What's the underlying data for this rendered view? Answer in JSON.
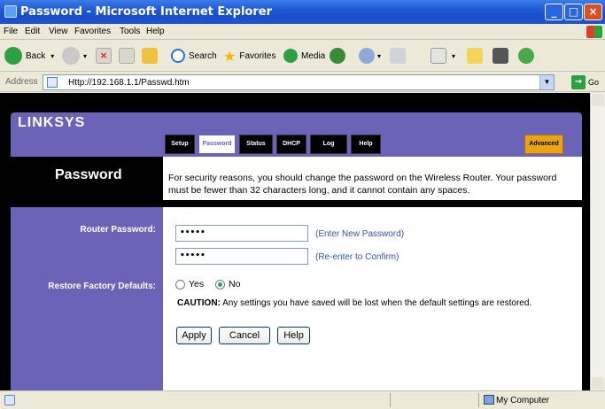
{
  "window": {
    "title": "Password - Microsoft Internet Explorer"
  },
  "menu": {
    "items": [
      "File",
      "Edit",
      "View",
      "Favorites",
      "Tools",
      "Help"
    ]
  },
  "toolbar": {
    "back_label": "Back",
    "search_label": "Search",
    "favorites_label": "Favorites",
    "media_label": "Media"
  },
  "address": {
    "label": "Address",
    "url": "Http://192.168.1.1/Passwd.htm",
    "go_label": "Go"
  },
  "router": {
    "logo": "LINKSYS",
    "tabs": [
      "Setup",
      "Password",
      "Status",
      "DHCP",
      "Log",
      "Help"
    ],
    "advanced_tab": "Advanced",
    "page_title": "Password",
    "intro_text": "For security reasons, you should change the password on the Wireless Router. Your password must be fewer than 32 characters long, and it cannot contain any spaces.",
    "router_password_label": "Router Password:",
    "password_value": "•••••",
    "confirm_value": "•••••",
    "enter_hint": "(Enter New Password)",
    "confirm_hint": "(Re-enter to Confirm)",
    "restore_label": "Restore Factory Defaults:",
    "yes_label": "Yes",
    "no_label": "No",
    "restore_selected": "No",
    "caution_prefix": "CAUTION:",
    "caution_text": "Any settings you have saved will be lost when the default settings are restored.",
    "apply_label": "Apply",
    "cancel_label": "Cancel",
    "help_label": "Help"
  },
  "status": {
    "zone": "My Computer"
  }
}
